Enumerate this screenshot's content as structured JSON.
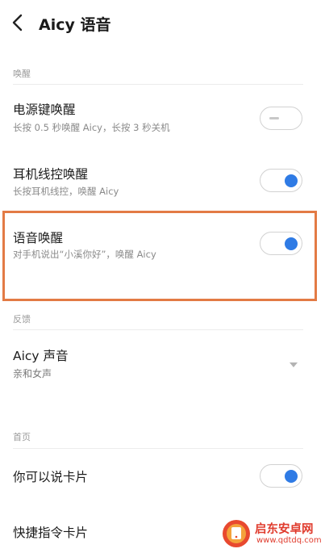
{
  "header": {
    "title": "Aicy 语音"
  },
  "sections": {
    "wake": {
      "label": "唤醒"
    },
    "feedback": {
      "label": "反馈"
    },
    "home": {
      "label": "首页"
    }
  },
  "rows": {
    "power_key": {
      "title": "电源键唤醒",
      "subtitle": "长按 0.5 秒唤醒 Aicy，长按 3 秒关机",
      "toggle": "off"
    },
    "earphone": {
      "title": "耳机线控唤醒",
      "subtitle": "长按耳机线控，唤醒 Aicy",
      "toggle": "on"
    },
    "voice": {
      "title": "语音唤醒",
      "subtitle": "对手机说出“小溪你好”，唤醒 Aicy",
      "toggle": "on"
    },
    "aicy_voice": {
      "title": "Aicy 声音",
      "value": "亲和女声"
    },
    "you_can_say": {
      "title": "你可以说卡片",
      "toggle": "on"
    },
    "shortcut": {
      "title": "快捷指令卡片"
    }
  },
  "watermark": {
    "name": "启东安卓网",
    "url": "www.qdtdq.com"
  },
  "colors": {
    "accent": "#2f7be5",
    "highlight": "#e37b45",
    "watermark": "#e03c2e"
  }
}
